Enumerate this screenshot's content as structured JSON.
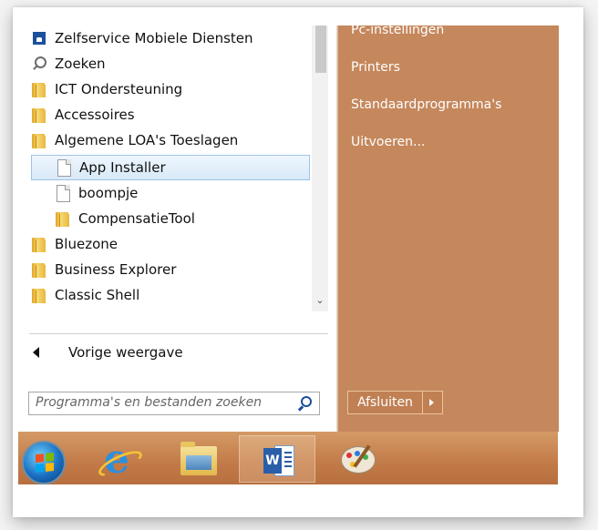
{
  "program_list": {
    "items": [
      {
        "label": "Zelfservice Mobiele Diensten",
        "icon": "mobile-services-icon"
      },
      {
        "label": "Zoeken",
        "icon": "search-icon"
      },
      {
        "label": "ICT Ondersteuning",
        "icon": "folder-icon"
      },
      {
        "label": "Accessoires",
        "icon": "folder-icon"
      },
      {
        "label": "Algemene LOA's Toeslagen",
        "icon": "folder-icon"
      },
      {
        "label": "App Installer",
        "icon": "document-icon"
      },
      {
        "label": "boompje",
        "icon": "document-icon"
      },
      {
        "label": "CompensatieTool",
        "icon": "folder-icon"
      },
      {
        "label": "Bluezone",
        "icon": "folder-icon"
      },
      {
        "label": "Business Explorer",
        "icon": "folder-icon"
      },
      {
        "label": "Classic Shell",
        "icon": "folder-icon"
      }
    ],
    "selected": "App Installer"
  },
  "back_label": "Vorige weergave",
  "search": {
    "placeholder": "Programma's en bestanden zoeken"
  },
  "right_panel": {
    "links": [
      "Pc-instellingen",
      "Printers",
      "Standaardprogramma's",
      "Uitvoeren..."
    ],
    "shutdown_label": "Afsluiten"
  },
  "taskbar": {
    "buttons": [
      "start-orb",
      "internet-explorer",
      "file-explorer",
      "microsoft-word",
      "paint"
    ],
    "active": "microsoft-word"
  },
  "colors": {
    "right_panel": "#c5875c",
    "taskbar": "#c27a48",
    "selection": "#d8e9f8"
  }
}
